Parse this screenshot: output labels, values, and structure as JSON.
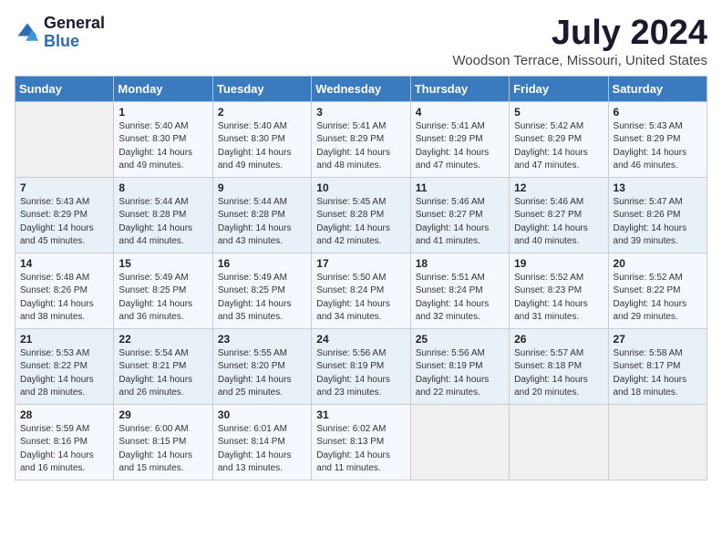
{
  "header": {
    "logo_general": "General",
    "logo_blue": "Blue",
    "month_title": "July 2024",
    "location": "Woodson Terrace, Missouri, United States"
  },
  "days_of_week": [
    "Sunday",
    "Monday",
    "Tuesday",
    "Wednesday",
    "Thursday",
    "Friday",
    "Saturday"
  ],
  "weeks": [
    [
      {
        "day": "",
        "info": ""
      },
      {
        "day": "1",
        "info": "Sunrise: 5:40 AM\nSunset: 8:30 PM\nDaylight: 14 hours\nand 49 minutes."
      },
      {
        "day": "2",
        "info": "Sunrise: 5:40 AM\nSunset: 8:30 PM\nDaylight: 14 hours\nand 49 minutes."
      },
      {
        "day": "3",
        "info": "Sunrise: 5:41 AM\nSunset: 8:29 PM\nDaylight: 14 hours\nand 48 minutes."
      },
      {
        "day": "4",
        "info": "Sunrise: 5:41 AM\nSunset: 8:29 PM\nDaylight: 14 hours\nand 47 minutes."
      },
      {
        "day": "5",
        "info": "Sunrise: 5:42 AM\nSunset: 8:29 PM\nDaylight: 14 hours\nand 47 minutes."
      },
      {
        "day": "6",
        "info": "Sunrise: 5:43 AM\nSunset: 8:29 PM\nDaylight: 14 hours\nand 46 minutes."
      }
    ],
    [
      {
        "day": "7",
        "info": "Sunrise: 5:43 AM\nSunset: 8:29 PM\nDaylight: 14 hours\nand 45 minutes."
      },
      {
        "day": "8",
        "info": "Sunrise: 5:44 AM\nSunset: 8:28 PM\nDaylight: 14 hours\nand 44 minutes."
      },
      {
        "day": "9",
        "info": "Sunrise: 5:44 AM\nSunset: 8:28 PM\nDaylight: 14 hours\nand 43 minutes."
      },
      {
        "day": "10",
        "info": "Sunrise: 5:45 AM\nSunset: 8:28 PM\nDaylight: 14 hours\nand 42 minutes."
      },
      {
        "day": "11",
        "info": "Sunrise: 5:46 AM\nSunset: 8:27 PM\nDaylight: 14 hours\nand 41 minutes."
      },
      {
        "day": "12",
        "info": "Sunrise: 5:46 AM\nSunset: 8:27 PM\nDaylight: 14 hours\nand 40 minutes."
      },
      {
        "day": "13",
        "info": "Sunrise: 5:47 AM\nSunset: 8:26 PM\nDaylight: 14 hours\nand 39 minutes."
      }
    ],
    [
      {
        "day": "14",
        "info": "Sunrise: 5:48 AM\nSunset: 8:26 PM\nDaylight: 14 hours\nand 38 minutes."
      },
      {
        "day": "15",
        "info": "Sunrise: 5:49 AM\nSunset: 8:25 PM\nDaylight: 14 hours\nand 36 minutes."
      },
      {
        "day": "16",
        "info": "Sunrise: 5:49 AM\nSunset: 8:25 PM\nDaylight: 14 hours\nand 35 minutes."
      },
      {
        "day": "17",
        "info": "Sunrise: 5:50 AM\nSunset: 8:24 PM\nDaylight: 14 hours\nand 34 minutes."
      },
      {
        "day": "18",
        "info": "Sunrise: 5:51 AM\nSunset: 8:24 PM\nDaylight: 14 hours\nand 32 minutes."
      },
      {
        "day": "19",
        "info": "Sunrise: 5:52 AM\nSunset: 8:23 PM\nDaylight: 14 hours\nand 31 minutes."
      },
      {
        "day": "20",
        "info": "Sunrise: 5:52 AM\nSunset: 8:22 PM\nDaylight: 14 hours\nand 29 minutes."
      }
    ],
    [
      {
        "day": "21",
        "info": "Sunrise: 5:53 AM\nSunset: 8:22 PM\nDaylight: 14 hours\nand 28 minutes."
      },
      {
        "day": "22",
        "info": "Sunrise: 5:54 AM\nSunset: 8:21 PM\nDaylight: 14 hours\nand 26 minutes."
      },
      {
        "day": "23",
        "info": "Sunrise: 5:55 AM\nSunset: 8:20 PM\nDaylight: 14 hours\nand 25 minutes."
      },
      {
        "day": "24",
        "info": "Sunrise: 5:56 AM\nSunset: 8:19 PM\nDaylight: 14 hours\nand 23 minutes."
      },
      {
        "day": "25",
        "info": "Sunrise: 5:56 AM\nSunset: 8:19 PM\nDaylight: 14 hours\nand 22 minutes."
      },
      {
        "day": "26",
        "info": "Sunrise: 5:57 AM\nSunset: 8:18 PM\nDaylight: 14 hours\nand 20 minutes."
      },
      {
        "day": "27",
        "info": "Sunrise: 5:58 AM\nSunset: 8:17 PM\nDaylight: 14 hours\nand 18 minutes."
      }
    ],
    [
      {
        "day": "28",
        "info": "Sunrise: 5:59 AM\nSunset: 8:16 PM\nDaylight: 14 hours\nand 16 minutes."
      },
      {
        "day": "29",
        "info": "Sunrise: 6:00 AM\nSunset: 8:15 PM\nDaylight: 14 hours\nand 15 minutes."
      },
      {
        "day": "30",
        "info": "Sunrise: 6:01 AM\nSunset: 8:14 PM\nDaylight: 14 hours\nand 13 minutes."
      },
      {
        "day": "31",
        "info": "Sunrise: 6:02 AM\nSunset: 8:13 PM\nDaylight: 14 hours\nand 11 minutes."
      },
      {
        "day": "",
        "info": ""
      },
      {
        "day": "",
        "info": ""
      },
      {
        "day": "",
        "info": ""
      }
    ]
  ]
}
